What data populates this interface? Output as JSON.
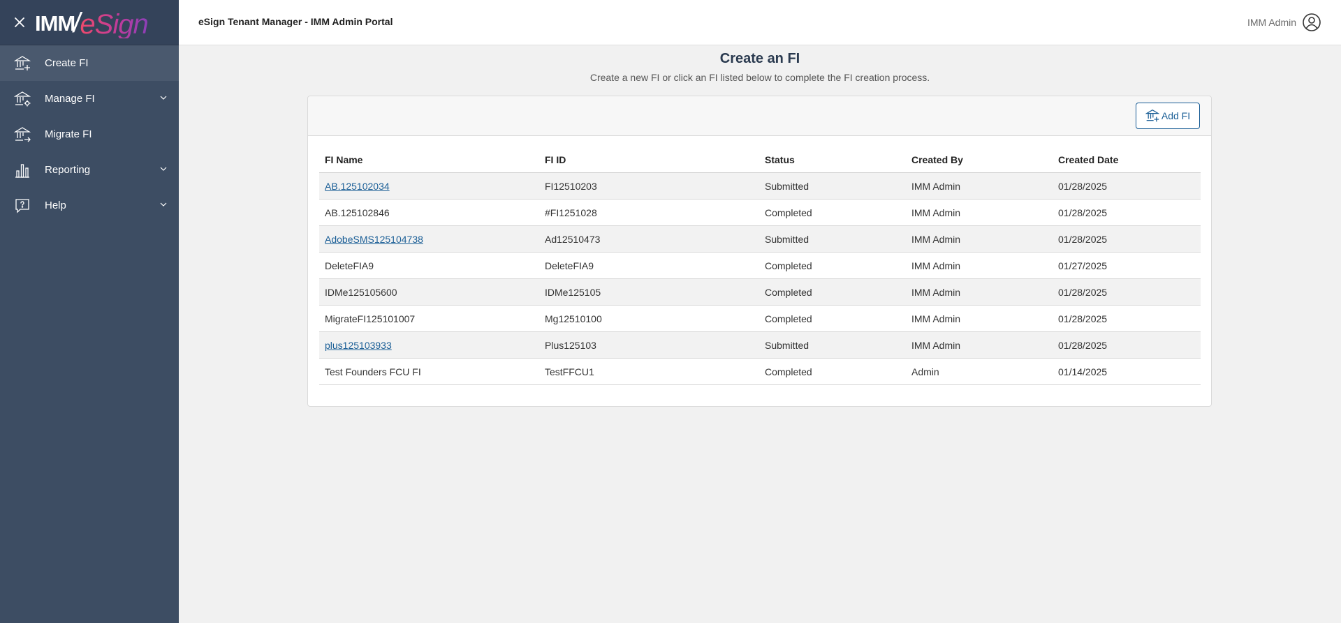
{
  "app": {
    "title": "eSign Tenant Manager - IMM Admin Portal",
    "logo_imm": "IMM",
    "logo_esign": "eSign",
    "user_name": "IMM Admin"
  },
  "sidebar": {
    "items": [
      {
        "label": "Create FI",
        "icon": "bank-plus-icon",
        "active": true
      },
      {
        "label": "Manage FI",
        "icon": "bank-gear-icon",
        "expandable": true
      },
      {
        "label": "Migrate FI",
        "icon": "bank-arrow-icon"
      },
      {
        "label": "Reporting",
        "icon": "bar-chart-icon",
        "expandable": true
      },
      {
        "label": "Help",
        "icon": "help-bubble-icon",
        "expandable": true
      }
    ]
  },
  "main": {
    "title": "Create an FI",
    "subtitle": "Create a new FI or click an FI listed below to complete the FI creation process.",
    "add_button_label": "Add FI"
  },
  "table": {
    "columns": [
      "FI Name",
      "FI ID",
      "Status",
      "Created By",
      "Created Date"
    ],
    "rows": [
      {
        "name": "AB.125102034",
        "id": "FI12510203",
        "status": "Submitted",
        "created_by": "IMM Admin",
        "date": "01/28/2025",
        "link": true
      },
      {
        "name": "AB.125102846",
        "id": "#FI1251028",
        "status": "Completed",
        "created_by": "IMM Admin",
        "date": "01/28/2025",
        "link": false
      },
      {
        "name": "AdobeSMS125104738",
        "id": "Ad12510473",
        "status": "Submitted",
        "created_by": "IMM Admin",
        "date": "01/28/2025",
        "link": true
      },
      {
        "name": "DeleteFIA9",
        "id": "DeleteFIA9",
        "status": "Completed",
        "created_by": "IMM Admin",
        "date": "01/27/2025",
        "link": false
      },
      {
        "name": "IDMe125105600",
        "id": "IDMe125105",
        "status": "Completed",
        "created_by": "IMM Admin",
        "date": "01/28/2025",
        "link": false
      },
      {
        "name": "MigrateFI125101007",
        "id": "Mg12510100",
        "status": "Completed",
        "created_by": "IMM Admin",
        "date": "01/28/2025",
        "link": false
      },
      {
        "name": "plus125103933",
        "id": "Plus125103",
        "status": "Submitted",
        "created_by": "IMM Admin",
        "date": "01/28/2025",
        "link": true
      },
      {
        "name": "Test Founders FCU FI",
        "id": "TestFFCU1",
        "status": "Completed",
        "created_by": "Admin",
        "date": "01/14/2025",
        "link": false
      }
    ]
  },
  "colors": {
    "sidebar_bg": "#3d4d63",
    "sidebar_active": "#4a596e",
    "link": "#1a5e96",
    "page_bg": "#f1f1f1"
  }
}
